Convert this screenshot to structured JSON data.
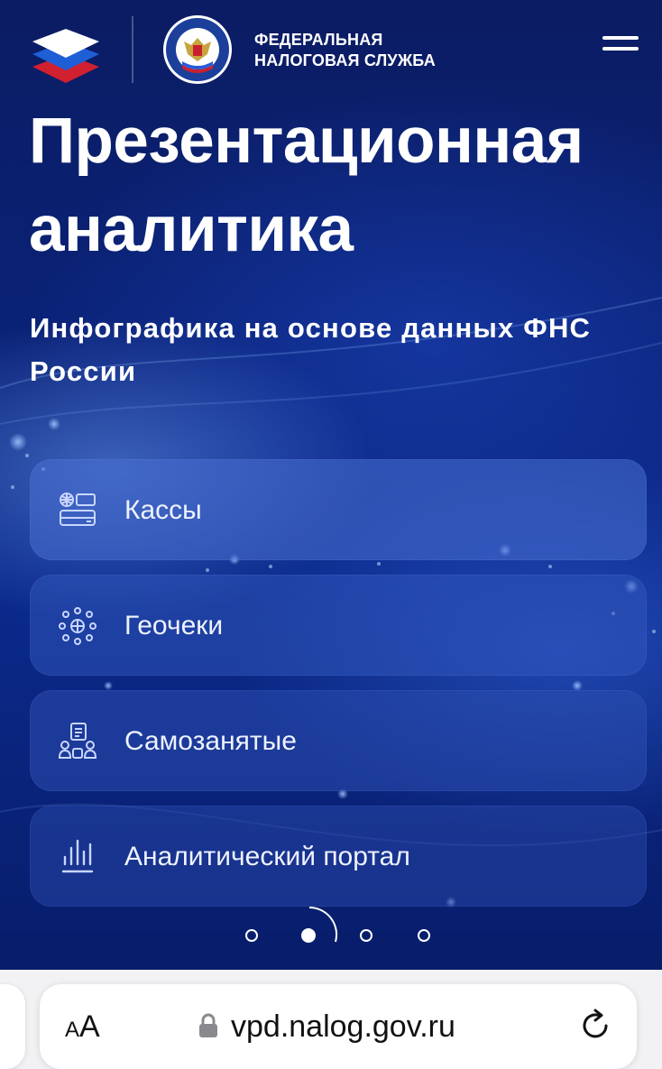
{
  "header": {
    "org_name_line1": "ФЕДЕРАЛЬНАЯ",
    "org_name_line2": "НАЛОГОВАЯ СЛУЖБА",
    "emblem_ring_text": "ФЕДЕРАЛЬНАЯ НАЛОГОВАЯ СЛУЖБА",
    "logo_icon": "layered-diamond-logo-icon",
    "emblem_icon": "double-headed-eagle-emblem-icon",
    "menu_icon": "hamburger-menu-icon"
  },
  "hero": {
    "title_line1": "Презентационная",
    "title_line2": "аналитика",
    "subtitle_line1": "Инфографика на основе данных ФНС",
    "subtitle_line2": "России"
  },
  "menu": {
    "items": [
      {
        "label": "Кассы",
        "icon": "cash-register-icon"
      },
      {
        "label": "Геочеки",
        "icon": "geo-network-icon"
      },
      {
        "label": "Самозанятые",
        "icon": "self-employed-people-icon"
      },
      {
        "label": "Аналитический портал",
        "icon": "bar-chart-icon"
      }
    ]
  },
  "carousel": {
    "slide_count": 4,
    "active_index": 1
  },
  "browser": {
    "text_size_label_small": "A",
    "text_size_label_large": "A",
    "url": "vpd.nalog.gov.ru"
  },
  "colors": {
    "hero_dark": "#0b1c63",
    "hero_mid": "#0b2a8c",
    "card_tint": "#4870d2",
    "browser_bg": "#f2f2f4"
  }
}
